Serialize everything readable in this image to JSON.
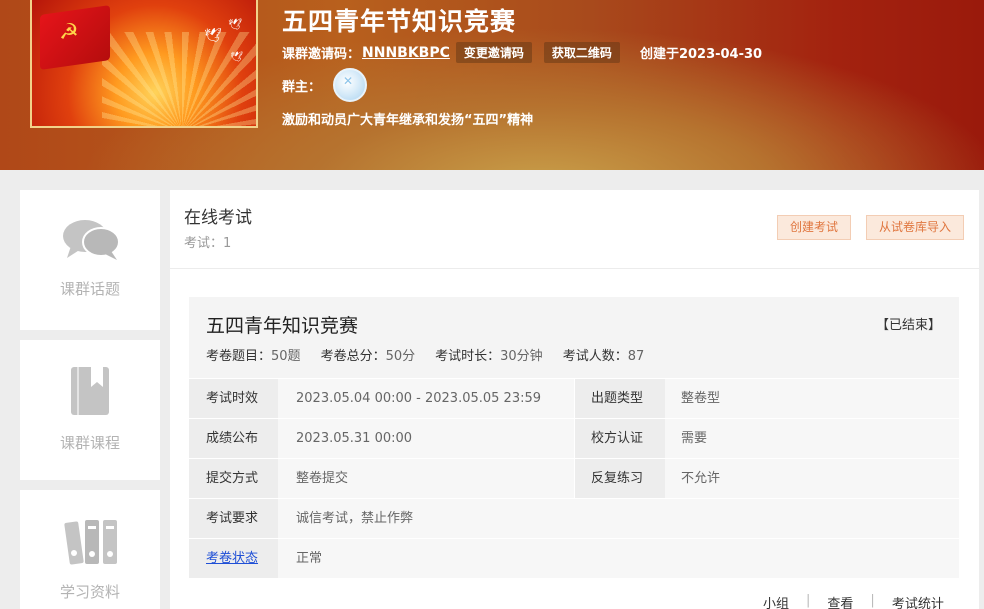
{
  "banner": {
    "title": "五四青年节知识竞赛",
    "invite_label": "课群邀请码：",
    "invite_code": "NNNBKBPC",
    "change_code_btn": "变更邀请码",
    "get_qr_btn": "获取二维码",
    "created": "创建于2023-04-30",
    "owner_label": "群主：",
    "description": "激励和动员广大青年继承和发扬“五四”精神"
  },
  "nav": [
    {
      "label": "课群话题",
      "icon": "chat-bubbles-icon"
    },
    {
      "label": "课群课程",
      "icon": "book-icon"
    },
    {
      "label": "学习资料",
      "icon": "binders-icon"
    }
  ],
  "main": {
    "title": "在线考试",
    "count": "考试：1",
    "create_btn": "创建考试",
    "import_btn": "从试卷库导入"
  },
  "exam": {
    "title": "五四青年知识竞赛",
    "status": "【已结束】",
    "stats": [
      {
        "label": "考卷题目：",
        "value": "50题"
      },
      {
        "label": "考卷总分：",
        "value": "50分"
      },
      {
        "label": "考试时长：",
        "value": "30分钟"
      },
      {
        "label": "考试人数：",
        "value": "87"
      }
    ],
    "rows": {
      "time_label": "考试时效",
      "time_value": "2023.05.04 00:00 - 2023.05.05 23:59",
      "type_label": "出题类型",
      "type_value": "整卷型",
      "publish_label": "成绩公布",
      "publish_value": "2023.05.31 00:00",
      "cert_label": "校方认证",
      "cert_value": "需要",
      "submit_label": "提交方式",
      "submit_value": "整卷提交",
      "repeat_label": "反复练习",
      "repeat_value": "不允许",
      "req_label": "考试要求",
      "req_value": "诚信考试，禁止作弊",
      "state_label": "考卷状态",
      "state_value": "正常"
    },
    "footer": [
      "小组",
      "查看",
      "考试统计"
    ]
  }
}
